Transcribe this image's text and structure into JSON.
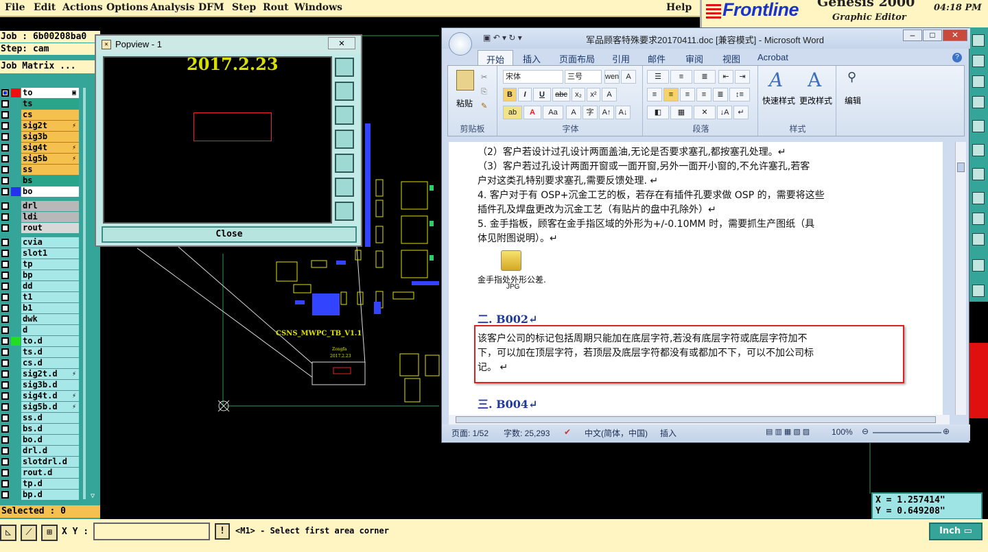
{
  "menu": {
    "items": [
      "File",
      "Edit",
      "Actions",
      "Options",
      "Analysis",
      "DFM",
      "Step",
      "Rout",
      "Windows"
    ],
    "help": "Help"
  },
  "brand": {
    "logo": "Frontline",
    "product": "Genesis 2000",
    "subtitle": "Graphic Editor",
    "clock": "04:18 PM"
  },
  "job": {
    "job_label": "Job : 6b00208ba0",
    "step_label": "Step: cam",
    "matrix_label": "Job Matrix ..."
  },
  "layers": [
    {
      "name": "to",
      "color": "#ffffff",
      "swatch": "#ee1111",
      "flag": "▣",
      "sel": true
    },
    {
      "name": "ts",
      "color": "#2aa58a",
      "swatch": "",
      "flag": ""
    },
    {
      "name": "cs",
      "color": "#f5c04e",
      "swatch": "",
      "flag": ""
    },
    {
      "name": "sig2t",
      "color": "#f5c04e",
      "swatch": "",
      "flag": "⚡"
    },
    {
      "name": "sig3b",
      "color": "#f5c04e",
      "swatch": "",
      "flag": ""
    },
    {
      "name": "sig4t",
      "color": "#f5c04e",
      "swatch": "",
      "flag": "⚡"
    },
    {
      "name": "sig5b",
      "color": "#f5c04e",
      "swatch": "",
      "flag": "⚡"
    },
    {
      "name": "ss",
      "color": "#f5c04e",
      "swatch": "",
      "flag": ""
    },
    {
      "name": "bs",
      "color": "#2aa58a",
      "swatch": "",
      "flag": ""
    },
    {
      "name": "bo",
      "color": "#ffffff",
      "swatch": "#2233ee",
      "flag": ""
    },
    {
      "name": "drl",
      "color": "#b8b8b8",
      "swatch": "",
      "flag": ""
    },
    {
      "name": "ldi",
      "color": "#b8b8b8",
      "swatch": "",
      "flag": ""
    },
    {
      "name": "rout",
      "color": "#d8d8d8",
      "swatch": "",
      "flag": ""
    },
    {
      "name": "cvia",
      "color": "#a6e8e8",
      "swatch": "",
      "flag": ""
    },
    {
      "name": "slot1",
      "color": "#a6e8e8",
      "swatch": "",
      "flag": ""
    },
    {
      "name": "tp",
      "color": "#a6e8e8",
      "swatch": "",
      "flag": ""
    },
    {
      "name": "bp",
      "color": "#a6e8e8",
      "swatch": "",
      "flag": ""
    },
    {
      "name": "dd",
      "color": "#a6e8e8",
      "swatch": "",
      "flag": ""
    },
    {
      "name": "t1",
      "color": "#a6e8e8",
      "swatch": "",
      "flag": ""
    },
    {
      "name": "b1",
      "color": "#a6e8e8",
      "swatch": "",
      "flag": ""
    },
    {
      "name": "dwk",
      "color": "#a6e8e8",
      "swatch": "",
      "flag": ""
    },
    {
      "name": "d",
      "color": "#a6e8e8",
      "swatch": "",
      "flag": ""
    },
    {
      "name": "to.d",
      "color": "#a6e8e8",
      "swatch": "#22dd22",
      "flag": ""
    },
    {
      "name": "ts.d",
      "color": "#a6e8e8",
      "swatch": "",
      "flag": ""
    },
    {
      "name": "cs.d",
      "color": "#a6e8e8",
      "swatch": "",
      "flag": ""
    },
    {
      "name": "sig2t.d",
      "color": "#a6e8e8",
      "swatch": "",
      "flag": "⚡"
    },
    {
      "name": "sig3b.d",
      "color": "#a6e8e8",
      "swatch": "",
      "flag": ""
    },
    {
      "name": "sig4t.d",
      "color": "#a6e8e8",
      "swatch": "",
      "flag": "⚡"
    },
    {
      "name": "sig5b.d",
      "color": "#a6e8e8",
      "swatch": "",
      "flag": "⚡"
    },
    {
      "name": "ss.d",
      "color": "#a6e8e8",
      "swatch": "",
      "flag": ""
    },
    {
      "name": "bs.d",
      "color": "#a6e8e8",
      "swatch": "",
      "flag": ""
    },
    {
      "name": "bo.d",
      "color": "#a6e8e8",
      "swatch": "",
      "flag": ""
    },
    {
      "name": "drl.d",
      "color": "#a6e8e8",
      "swatch": "",
      "flag": ""
    },
    {
      "name": "slotdrl.d",
      "color": "#a6e8e8",
      "swatch": "",
      "flag": ""
    },
    {
      "name": "rout.d",
      "color": "#a6e8e8",
      "swatch": "",
      "flag": ""
    },
    {
      "name": "tp.d",
      "color": "#a6e8e8",
      "swatch": "",
      "flag": ""
    },
    {
      "name": "bp.d",
      "color": "#a6e8e8",
      "swatch": "",
      "flag": ""
    }
  ],
  "selected_label": "Selected : 0",
  "status": {
    "xy_label": "X Y :",
    "xy_value": "",
    "prompt": "<M1> - Select first area corner",
    "unit": "Inch"
  },
  "coords": {
    "x": "X = 1.257414\"",
    "y": "Y = 0.649208\""
  },
  "popview": {
    "title": "Popview - 1",
    "date": "2017.2.23",
    "close": "Close"
  },
  "board": {
    "label": "CSNS_MWPC_TB_V1.1",
    "small1": "Zongfa",
    "small2": "2017.2.23"
  },
  "word": {
    "title": "军品顾客特殊要求20170411.doc [兼容模式] - Microsoft Word",
    "tabs": [
      "开始",
      "插入",
      "页面布局",
      "引用",
      "邮件",
      "审阅",
      "视图",
      "Acrobat"
    ],
    "ribbon": {
      "paste": "粘贴",
      "clipboard": "剪贴板",
      "font_name": "宋体",
      "font_size": "三号",
      "font_group": "字体",
      "para_group": "段落",
      "quick_style": "快速样式",
      "change_style": "更改样式",
      "style_group": "样式",
      "edit": "编辑"
    },
    "lines": [
      "（2）客户若设计过孔设计两面盖油,无论是否要求塞孔,都按塞孔处理。↵",
      "（3）客户若过孔设计两面开窗或一面开窗,另外一面开小窗的,不允许塞孔,若客",
      "户对这类孔特别要求塞孔,需要反馈处理. ↵",
      "4. 客户对于有 OSP+沉金工艺的板，若存在有插件孔要求做 OSP 的，需要将这些",
      "插件孔及焊盘更改为沉金工艺（有贴片的盘中孔除外）↵",
      "5. 金手指板，顾客在金手指区域的外形为+/-0.10MM 时，需要抓生产图纸（具",
      "体见附图说明）。↵"
    ],
    "attachment": "金手指处外形公差.",
    "attachment_ext": "JPG",
    "heading2": "二. B002↵",
    "red_lines": [
      "该客户公司的标记包括周期只能加在底层字符,若没有底层字符或底层字符加不",
      "下，可以加在顶层字符，若顶层及底层字符都没有或都加不下，可以不加公司标",
      "记。  ↵"
    ],
    "heading3": "三. B004↵",
    "status": {
      "page": "页面: 1/52",
      "words": "字数: 25,293",
      "lang": "中文(简体，中国)",
      "mode": "插入",
      "zoom": "100%"
    }
  },
  "colors": {
    "menu_bg": "#fff5c2",
    "teal": "#35a59a",
    "word_blue": "#1e3a9a",
    "highlight_red": "#dd2222"
  }
}
